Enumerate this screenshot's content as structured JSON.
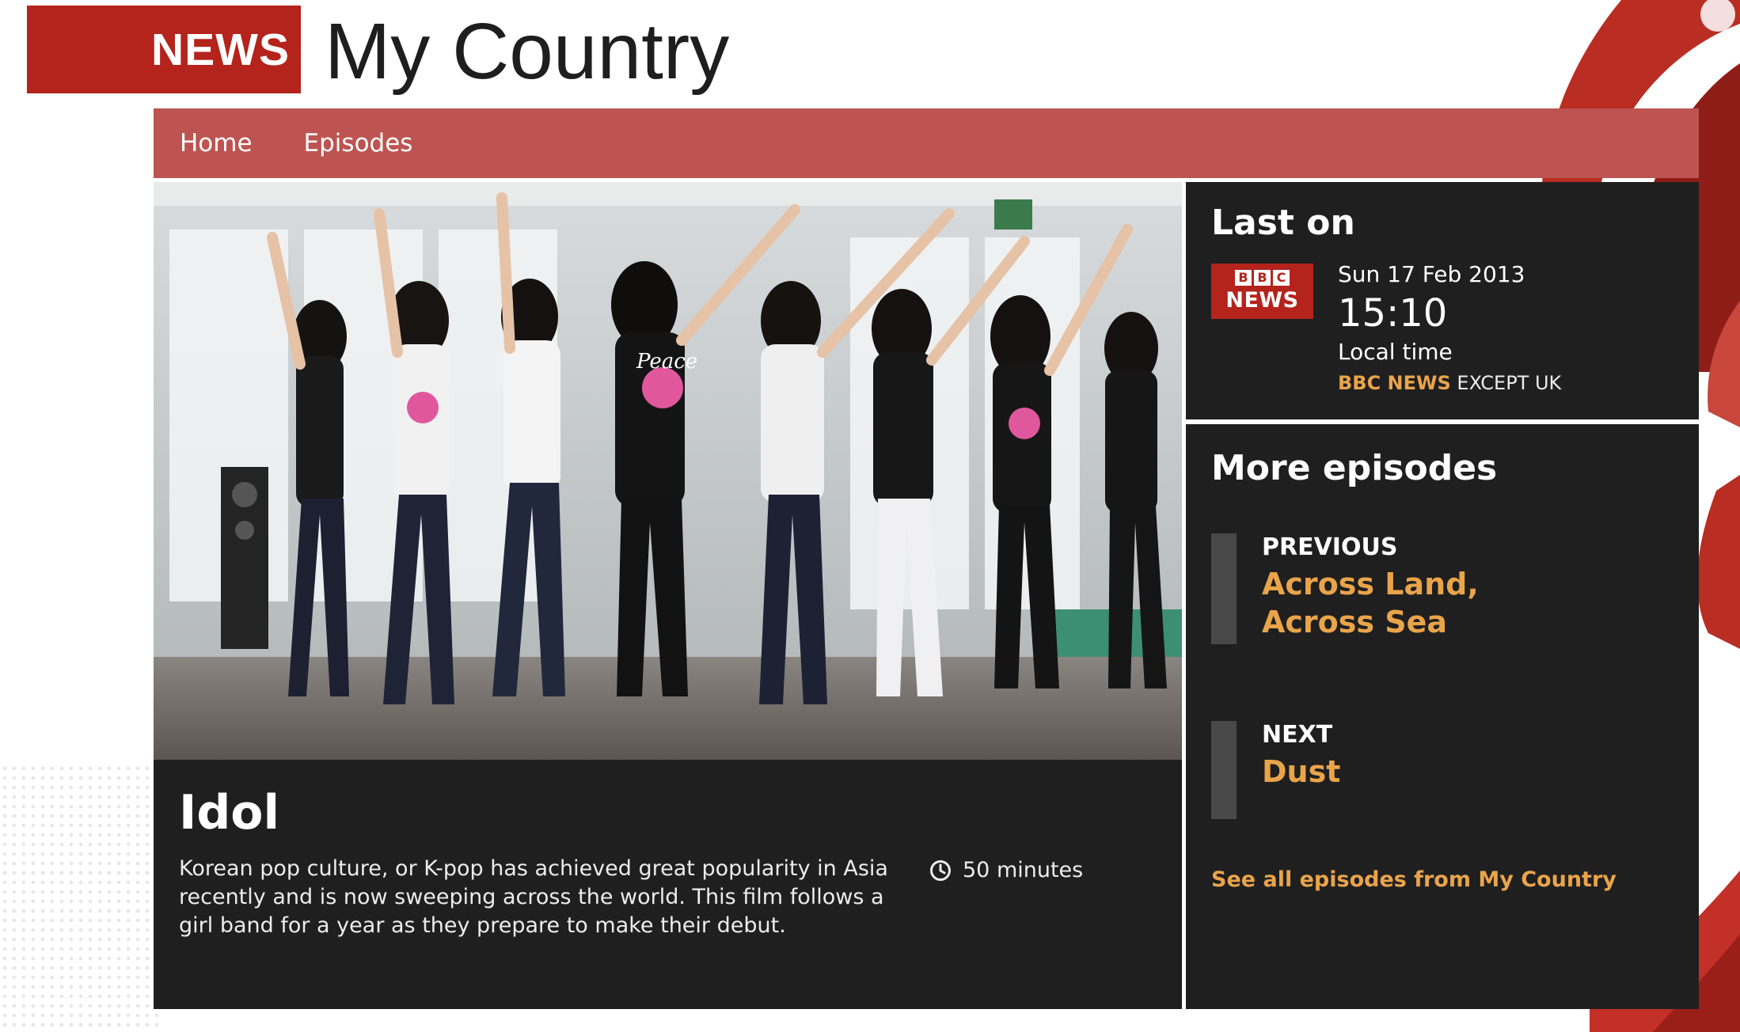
{
  "header": {
    "brand": "NEWS",
    "title": "My Country"
  },
  "nav": {
    "items": [
      {
        "label": "Home"
      },
      {
        "label": "Episodes"
      }
    ]
  },
  "episode": {
    "title": "Idol",
    "description": "Korean pop culture, or K-pop has achieved great popularity in Asia recently and is now sweeping across the world. This film follows a girl band for a year as they prepare to make their debut.",
    "duration": "50 minutes",
    "image_shirt_text": "Peace"
  },
  "last_on": {
    "heading": "Last on",
    "logo_letters": [
      "B",
      "B",
      "C"
    ],
    "logo_word": "NEWS",
    "date": "Sun 17 Feb 2013",
    "time": "15:10",
    "local": "Local time",
    "channel": "BBC NEWS",
    "channel_suffix": " EXCEPT UK"
  },
  "more_episodes": {
    "heading": "More episodes",
    "previous": {
      "label": "PREVIOUS",
      "title": "Across Land, Across Sea"
    },
    "next": {
      "label": "NEXT",
      "title": "Dust"
    },
    "see_all": "See all episodes from My Country"
  },
  "colors": {
    "brand_red": "#b4231c",
    "nav_red": "#bd5451",
    "panel_dark": "#1f1f1f",
    "accent_orange": "#e9a44a"
  }
}
